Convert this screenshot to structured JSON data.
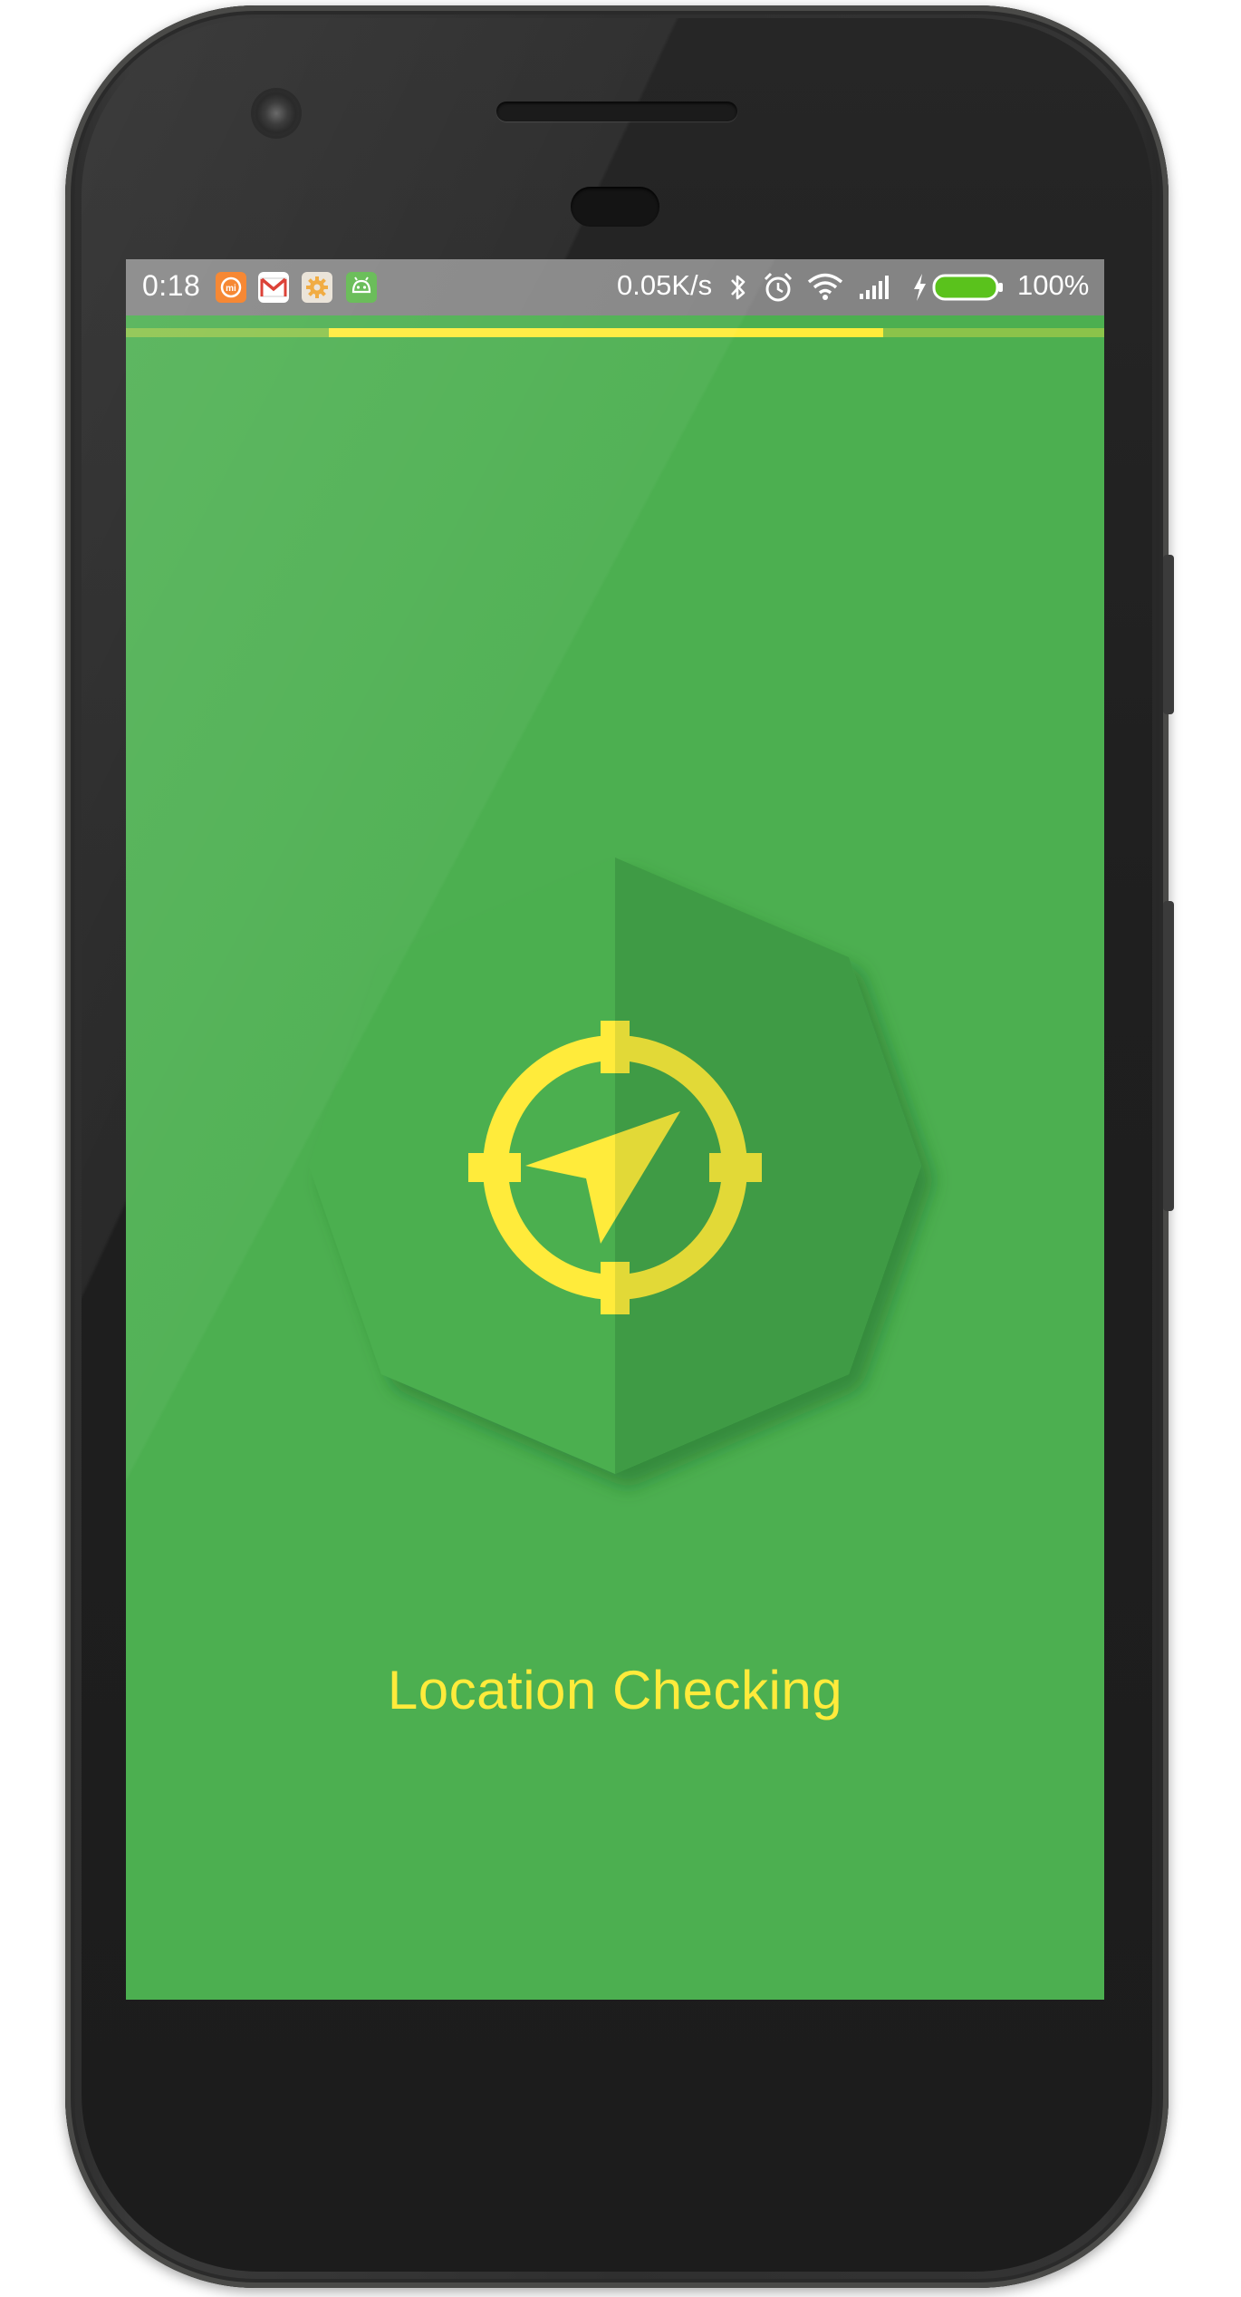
{
  "status_bar": {
    "time": "0:18",
    "notification_icons": [
      "mi-icon",
      "gmail-icon",
      "settings-icon",
      "android-icon"
    ],
    "network_speed": "0.05K/s",
    "system_icons": [
      "bluetooth-icon",
      "alarm-icon",
      "wifi-icon",
      "signal-icon",
      "charging-icon",
      "battery-icon"
    ],
    "battery_percent": "100%"
  },
  "progress": {
    "state": "indeterminate",
    "track_color": "#8bc34a",
    "bar_color": "#ffeb3b"
  },
  "screen": {
    "background_color": "#4caf50",
    "badge_icon": "location-target-icon",
    "label": "Location Checking",
    "accent_color": "#ffeb3b"
  }
}
